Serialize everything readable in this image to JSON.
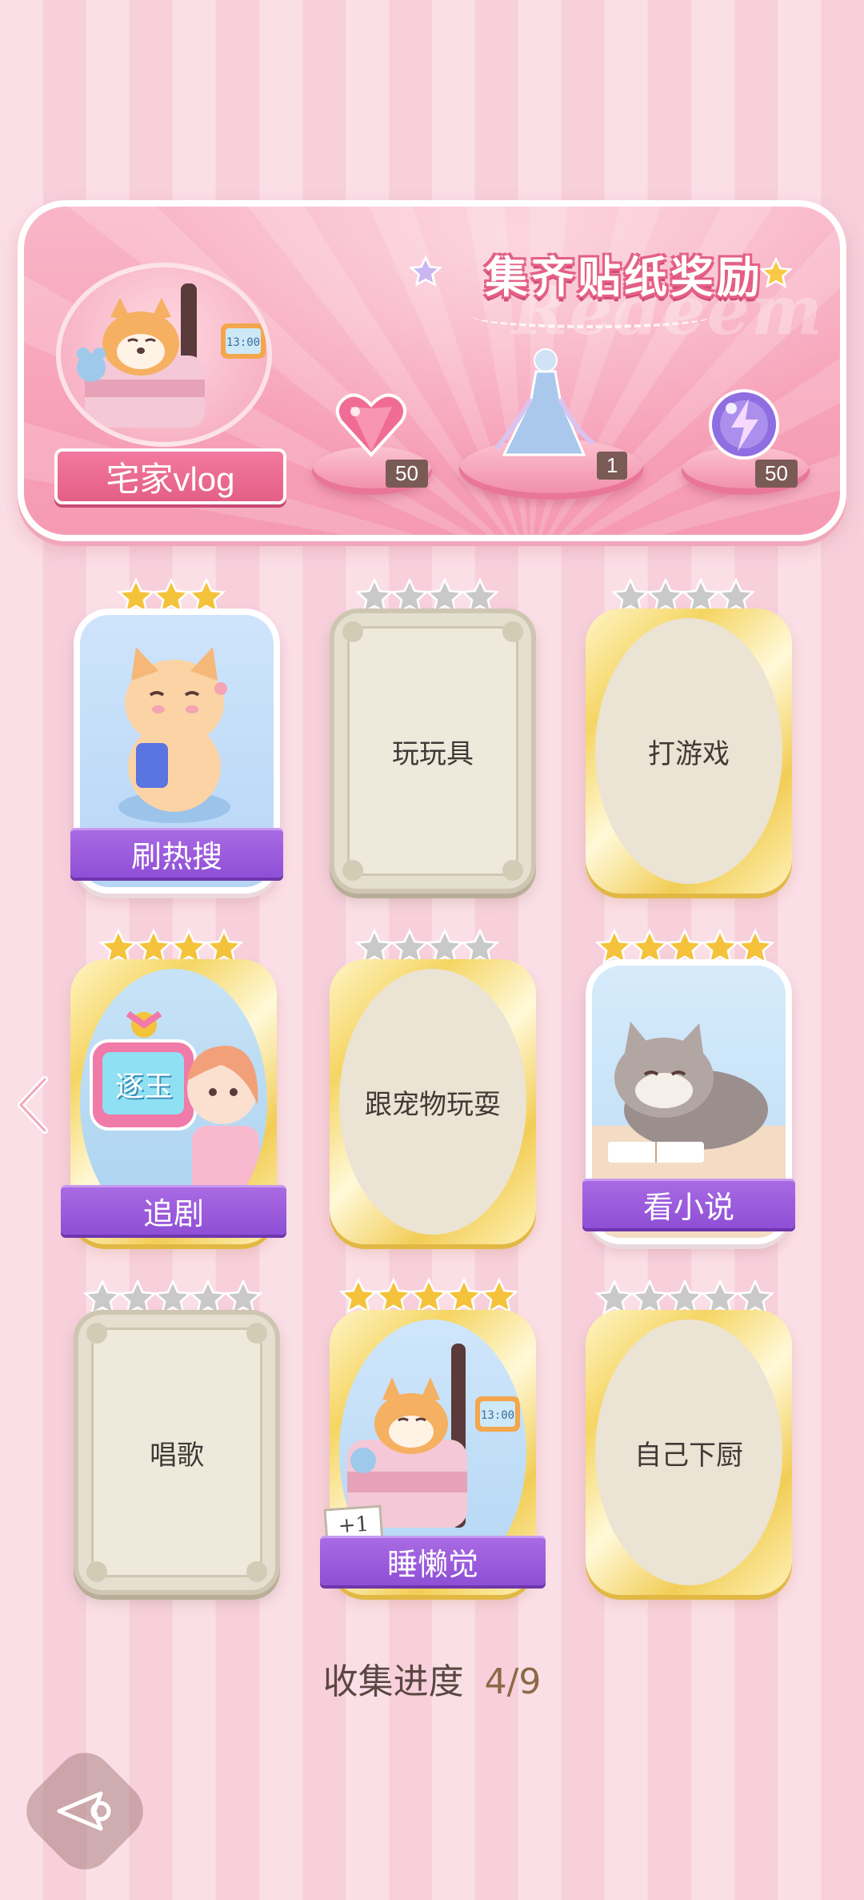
{
  "banner": {
    "title": "集齐贴纸奖励",
    "watermark": "Redeem",
    "collection_name": "宅家vlog",
    "rewards": [
      {
        "icon": "pink-heart-gem-icon",
        "count": "50"
      },
      {
        "icon": "dress-outfit-icon",
        "count": "1"
      },
      {
        "icon": "lightning-orb-icon",
        "count": "50"
      }
    ]
  },
  "cards": [
    {
      "label": "刷热搜",
      "state": "collected",
      "stars": 3,
      "star_color": "gold"
    },
    {
      "label": "玩玩具",
      "state": "locked-frame",
      "stars": 4,
      "star_color": "silver"
    },
    {
      "label": "打游戏",
      "state": "locked-gold",
      "stars": 4,
      "star_color": "silver"
    },
    {
      "label": "追剧",
      "state": "collected",
      "stars": 4,
      "star_color": "gold",
      "tv_text": "逐玉"
    },
    {
      "label": "跟宠物玩耍",
      "state": "locked-gold",
      "stars": 4,
      "star_color": "silver"
    },
    {
      "label": "看小说",
      "state": "collected",
      "stars": 5,
      "star_color": "gold"
    },
    {
      "label": "唱歌",
      "state": "locked-frame",
      "stars": 5,
      "star_color": "silver"
    },
    {
      "label": "睡懒觉",
      "state": "collected",
      "stars": 5,
      "star_color": "gold",
      "badge": "+1"
    },
    {
      "label": "自己下厨",
      "state": "locked-gold",
      "stars": 5,
      "star_color": "silver"
    }
  ],
  "progress": {
    "label": "收集进度",
    "value": "4/9"
  },
  "nav": {
    "prev_icon": "chevron-left-icon",
    "back_icon": "back-arrow-icon"
  },
  "colors": {
    "purple_banner": "#9b5ddc",
    "pink_banner": "#f7a2b9",
    "gold_star": "#f5c33b",
    "silver_star": "#c9c9c9"
  }
}
